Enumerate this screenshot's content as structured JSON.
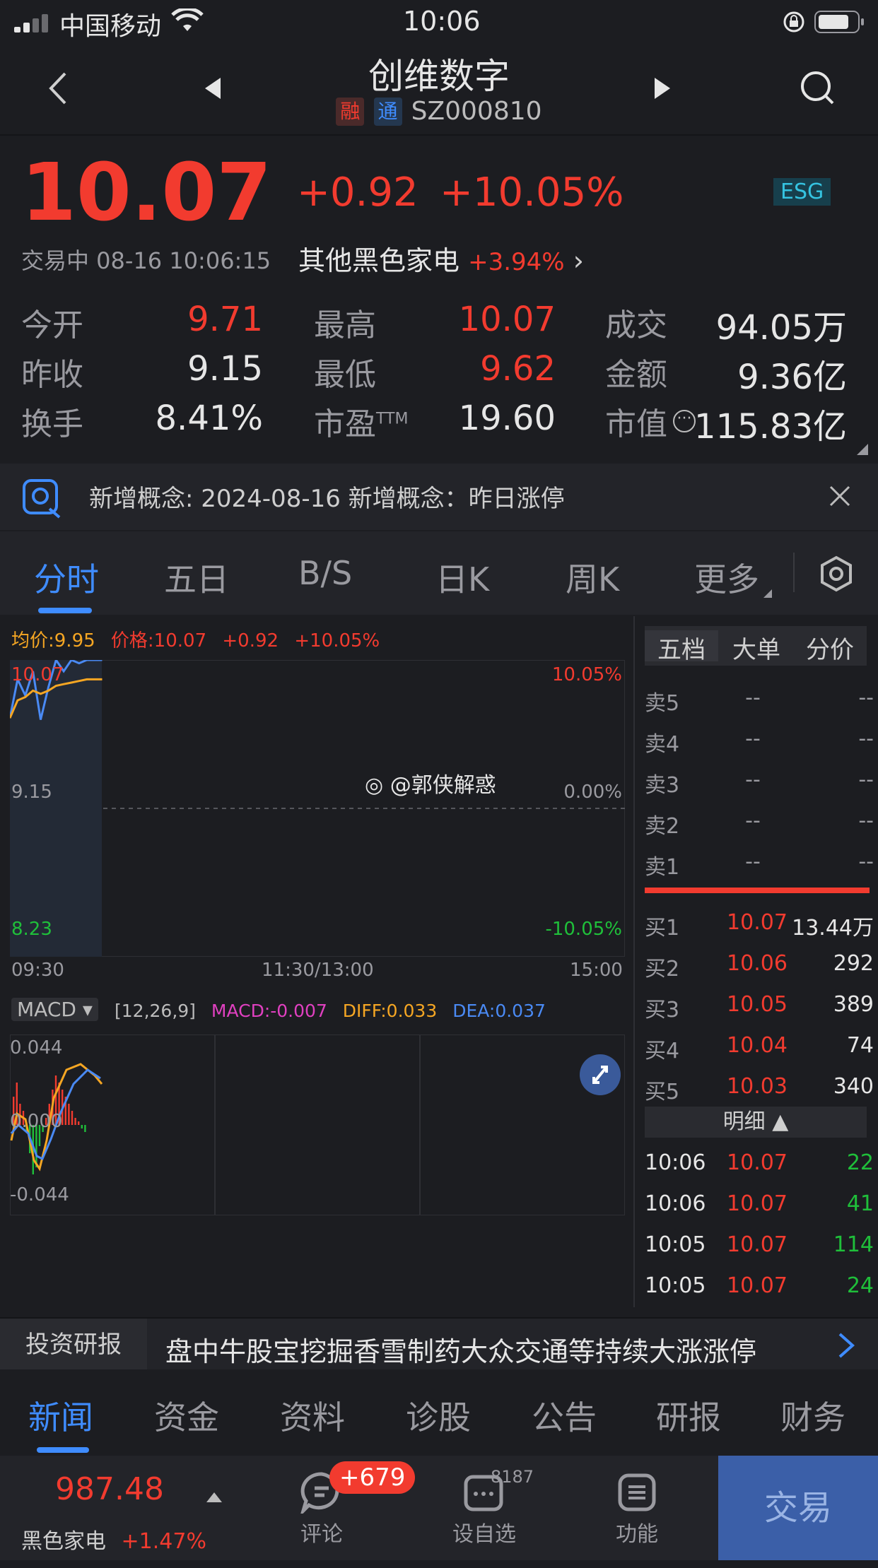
{
  "status": {
    "carrier": "中国移动",
    "time": "10:06"
  },
  "nav": {
    "title": "创维数字",
    "tag_rong": "融",
    "tag_tong": "通",
    "code": "SZ000810"
  },
  "quote": {
    "price": "10.07",
    "change": "+0.92",
    "change_pct": "+10.05%",
    "esg": "ESG",
    "status_time": "交易中 08-16 10:06:15",
    "sector_name": "其他黑色家电",
    "sector_pct": "+3.94%",
    "fields": [
      {
        "label": "今开",
        "value": "9.71"
      },
      {
        "label": "最高",
        "value": "10.07"
      },
      {
        "label": "成交",
        "value": "94.05万"
      },
      {
        "label": "昨收",
        "value": "9.15"
      },
      {
        "label": "最低",
        "value": "9.62"
      },
      {
        "label": "金额",
        "value": "9.36亿"
      },
      {
        "label": "换手",
        "value": "8.41%"
      },
      {
        "label": "市盈",
        "label_sup": "TTM",
        "value": "19.60"
      },
      {
        "label": "市值",
        "value": "115.83亿"
      }
    ]
  },
  "notice": {
    "text": "新增概念: 2024-08-16 新增概念：昨日涨停"
  },
  "chart_tabs": [
    "分时",
    "五日",
    "B/S",
    "日K",
    "周K",
    "更多"
  ],
  "intraday": {
    "avg_label": "均价:9.95",
    "price_label": "价格:10.07",
    "chg": "+0.92",
    "pct": "+10.05%",
    "y_top": "10.07",
    "y_mid": "9.15",
    "y_bot": "8.23",
    "pct_top": "10.05%",
    "pct_mid": "0.00%",
    "pct_bot": "-10.05%",
    "x_start": "09:30",
    "x_mid": "11:30/13:00",
    "x_end": "15:00",
    "watermark": "@郭侠解惑"
  },
  "chart_data": {
    "type": "line",
    "title": "",
    "xlabel": "",
    "ylabel": "",
    "ylim": [
      8.23,
      10.07
    ],
    "x_ticks": [
      "09:30",
      "11:30/13:00",
      "15:00"
    ],
    "series": [
      {
        "name": "价格",
        "x": [
          0,
          3,
          6,
          9,
          12,
          15,
          18,
          21,
          24,
          27,
          30,
          33,
          36
        ],
        "values": [
          9.71,
          9.95,
          9.85,
          10.0,
          9.7,
          9.9,
          10.07,
          10.0,
          10.07,
          10.05,
          10.07,
          10.07,
          10.07
        ]
      },
      {
        "name": "均价",
        "x": [
          0,
          3,
          6,
          9,
          12,
          15,
          18,
          21,
          24,
          27,
          30,
          33,
          36
        ],
        "values": [
          9.71,
          9.82,
          9.84,
          9.88,
          9.86,
          9.88,
          9.91,
          9.92,
          9.93,
          9.94,
          9.95,
          9.95,
          9.95
        ]
      }
    ]
  },
  "macd": {
    "name": "MACD",
    "params": "[12,26,9]",
    "macd": "MACD:-0.007",
    "diff": "DIFF:0.033",
    "dea": "DEA:0.037",
    "y_top": "0.044",
    "y_mid": "0.000",
    "y_bot": "-0.044"
  },
  "orderbook": {
    "tabs": [
      "五档",
      "大单",
      "分价"
    ],
    "asks": [
      {
        "label": "卖5",
        "price": "--",
        "vol": "--"
      },
      {
        "label": "卖4",
        "price": "--",
        "vol": "--"
      },
      {
        "label": "卖3",
        "price": "--",
        "vol": "--"
      },
      {
        "label": "卖2",
        "price": "--",
        "vol": "--"
      },
      {
        "label": "卖1",
        "price": "--",
        "vol": "--"
      }
    ],
    "bids": [
      {
        "label": "买1",
        "price": "10.07",
        "vol": "13.44万"
      },
      {
        "label": "买2",
        "price": "10.06",
        "vol": "292"
      },
      {
        "label": "买3",
        "price": "10.05",
        "vol": "389"
      },
      {
        "label": "买4",
        "price": "10.04",
        "vol": "74"
      },
      {
        "label": "买5",
        "price": "10.03",
        "vol": "340"
      }
    ],
    "detail_label": "明细",
    "ticks": [
      {
        "time": "10:06",
        "price": "10.07",
        "vol": "22"
      },
      {
        "time": "10:06",
        "price": "10.07",
        "vol": "41"
      },
      {
        "time": "10:05",
        "price": "10.07",
        "vol": "114"
      },
      {
        "time": "10:05",
        "price": "10.07",
        "vol": "24"
      }
    ]
  },
  "research": {
    "label": "投资研报",
    "text": "盘中牛股宝挖掘香雪制药大众交通等持续大涨涨停"
  },
  "bottom_tabs": [
    "新闻",
    "资金",
    "资料",
    "诊股",
    "公告",
    "研报",
    "财务"
  ],
  "footer": {
    "index_value": "987.48",
    "index_name": "黑色家电",
    "index_pct": "+1.47%",
    "comment_label": "评论",
    "comment_badge": "+679",
    "watch_label": "设自选",
    "watch_count": "8187",
    "func_label": "功能",
    "trade_label": "交易"
  }
}
